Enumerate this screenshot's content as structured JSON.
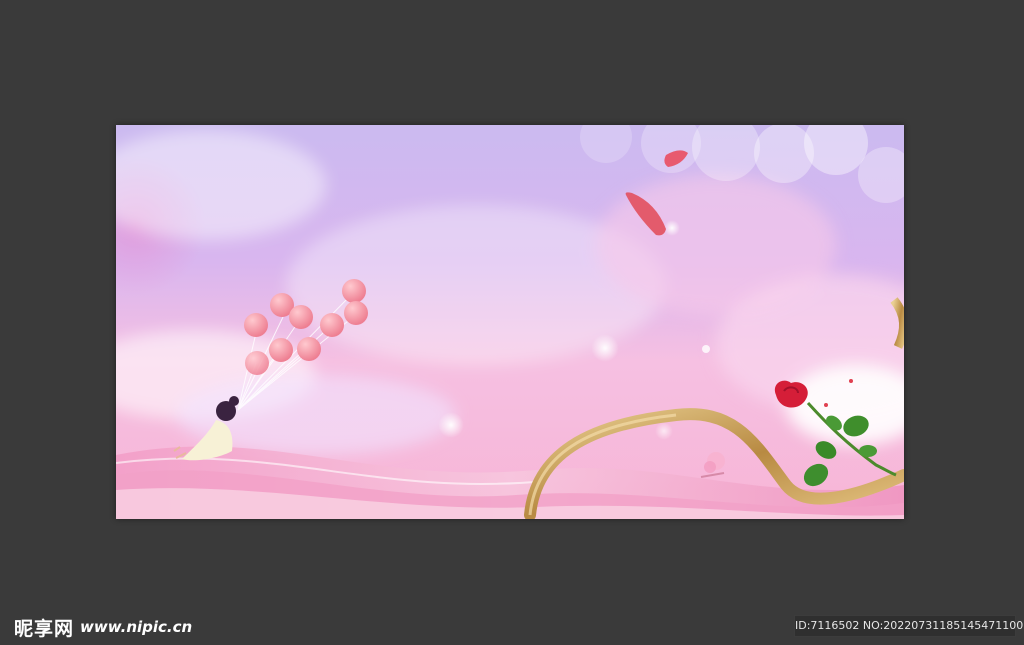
{
  "page": {
    "background_color": "#3a3a3a"
  },
  "artwork": {
    "subject": "pink romantic sky banner",
    "palette": {
      "sky_top": "#c8b4ee",
      "sky_mid": "#f6bfe0",
      "sky_bottom": "#f3a9cf",
      "ribbon_gold": "#c9a35c",
      "rose_red": "#d8203a",
      "leaf_green": "#3e8e2e",
      "balloon_pink": "#f08a9a"
    },
    "icons": [
      "girl-with-balloons",
      "rose-icon",
      "gold-ribbon",
      "petal-icon",
      "cloud",
      "bokeh-light"
    ]
  },
  "watermark": {
    "logo_text": "昵享网",
    "site_url": "www.nipic.cn",
    "id_text": "ID:7116502 NO:20220731185145471100"
  }
}
